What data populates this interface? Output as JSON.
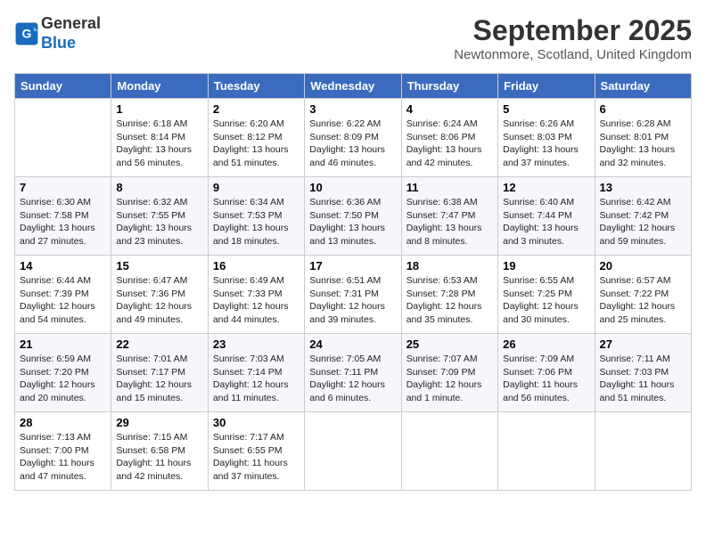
{
  "header": {
    "logo_line1": "General",
    "logo_line2": "Blue",
    "month": "September 2025",
    "location": "Newtonmore, Scotland, United Kingdom"
  },
  "weekdays": [
    "Sunday",
    "Monday",
    "Tuesday",
    "Wednesday",
    "Thursday",
    "Friday",
    "Saturday"
  ],
  "weeks": [
    [
      {
        "day": "",
        "info": ""
      },
      {
        "day": "1",
        "info": "Sunrise: 6:18 AM\nSunset: 8:14 PM\nDaylight: 13 hours\nand 56 minutes."
      },
      {
        "day": "2",
        "info": "Sunrise: 6:20 AM\nSunset: 8:12 PM\nDaylight: 13 hours\nand 51 minutes."
      },
      {
        "day": "3",
        "info": "Sunrise: 6:22 AM\nSunset: 8:09 PM\nDaylight: 13 hours\nand 46 minutes."
      },
      {
        "day": "4",
        "info": "Sunrise: 6:24 AM\nSunset: 8:06 PM\nDaylight: 13 hours\nand 42 minutes."
      },
      {
        "day": "5",
        "info": "Sunrise: 6:26 AM\nSunset: 8:03 PM\nDaylight: 13 hours\nand 37 minutes."
      },
      {
        "day": "6",
        "info": "Sunrise: 6:28 AM\nSunset: 8:01 PM\nDaylight: 13 hours\nand 32 minutes."
      }
    ],
    [
      {
        "day": "7",
        "info": "Sunrise: 6:30 AM\nSunset: 7:58 PM\nDaylight: 13 hours\nand 27 minutes."
      },
      {
        "day": "8",
        "info": "Sunrise: 6:32 AM\nSunset: 7:55 PM\nDaylight: 13 hours\nand 23 minutes."
      },
      {
        "day": "9",
        "info": "Sunrise: 6:34 AM\nSunset: 7:53 PM\nDaylight: 13 hours\nand 18 minutes."
      },
      {
        "day": "10",
        "info": "Sunrise: 6:36 AM\nSunset: 7:50 PM\nDaylight: 13 hours\nand 13 minutes."
      },
      {
        "day": "11",
        "info": "Sunrise: 6:38 AM\nSunset: 7:47 PM\nDaylight: 13 hours\nand 8 minutes."
      },
      {
        "day": "12",
        "info": "Sunrise: 6:40 AM\nSunset: 7:44 PM\nDaylight: 13 hours\nand 3 minutes."
      },
      {
        "day": "13",
        "info": "Sunrise: 6:42 AM\nSunset: 7:42 PM\nDaylight: 12 hours\nand 59 minutes."
      }
    ],
    [
      {
        "day": "14",
        "info": "Sunrise: 6:44 AM\nSunset: 7:39 PM\nDaylight: 12 hours\nand 54 minutes."
      },
      {
        "day": "15",
        "info": "Sunrise: 6:47 AM\nSunset: 7:36 PM\nDaylight: 12 hours\nand 49 minutes."
      },
      {
        "day": "16",
        "info": "Sunrise: 6:49 AM\nSunset: 7:33 PM\nDaylight: 12 hours\nand 44 minutes."
      },
      {
        "day": "17",
        "info": "Sunrise: 6:51 AM\nSunset: 7:31 PM\nDaylight: 12 hours\nand 39 minutes."
      },
      {
        "day": "18",
        "info": "Sunrise: 6:53 AM\nSunset: 7:28 PM\nDaylight: 12 hours\nand 35 minutes."
      },
      {
        "day": "19",
        "info": "Sunrise: 6:55 AM\nSunset: 7:25 PM\nDaylight: 12 hours\nand 30 minutes."
      },
      {
        "day": "20",
        "info": "Sunrise: 6:57 AM\nSunset: 7:22 PM\nDaylight: 12 hours\nand 25 minutes."
      }
    ],
    [
      {
        "day": "21",
        "info": "Sunrise: 6:59 AM\nSunset: 7:20 PM\nDaylight: 12 hours\nand 20 minutes."
      },
      {
        "day": "22",
        "info": "Sunrise: 7:01 AM\nSunset: 7:17 PM\nDaylight: 12 hours\nand 15 minutes."
      },
      {
        "day": "23",
        "info": "Sunrise: 7:03 AM\nSunset: 7:14 PM\nDaylight: 12 hours\nand 11 minutes."
      },
      {
        "day": "24",
        "info": "Sunrise: 7:05 AM\nSunset: 7:11 PM\nDaylight: 12 hours\nand 6 minutes."
      },
      {
        "day": "25",
        "info": "Sunrise: 7:07 AM\nSunset: 7:09 PM\nDaylight: 12 hours\nand 1 minute."
      },
      {
        "day": "26",
        "info": "Sunrise: 7:09 AM\nSunset: 7:06 PM\nDaylight: 11 hours\nand 56 minutes."
      },
      {
        "day": "27",
        "info": "Sunrise: 7:11 AM\nSunset: 7:03 PM\nDaylight: 11 hours\nand 51 minutes."
      }
    ],
    [
      {
        "day": "28",
        "info": "Sunrise: 7:13 AM\nSunset: 7:00 PM\nDaylight: 11 hours\nand 47 minutes."
      },
      {
        "day": "29",
        "info": "Sunrise: 7:15 AM\nSunset: 6:58 PM\nDaylight: 11 hours\nand 42 minutes."
      },
      {
        "day": "30",
        "info": "Sunrise: 7:17 AM\nSunset: 6:55 PM\nDaylight: 11 hours\nand 37 minutes."
      },
      {
        "day": "",
        "info": ""
      },
      {
        "day": "",
        "info": ""
      },
      {
        "day": "",
        "info": ""
      },
      {
        "day": "",
        "info": ""
      }
    ]
  ]
}
